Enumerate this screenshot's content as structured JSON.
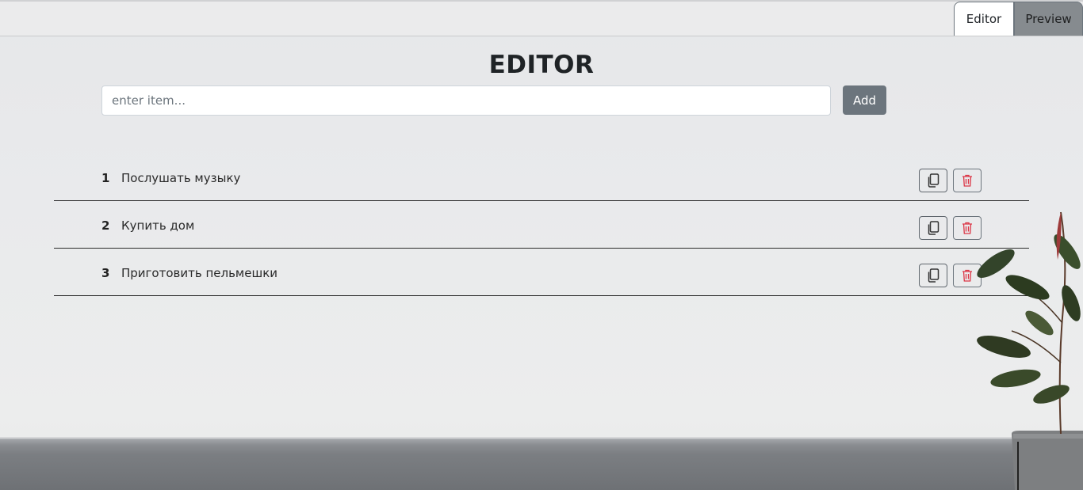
{
  "tabs": [
    {
      "label": "Editor",
      "active": true
    },
    {
      "label": "Preview",
      "active": false
    }
  ],
  "page_title": "EDITOR",
  "input": {
    "placeholder": "enter item...",
    "value": ""
  },
  "add_button_label": "Add",
  "items": [
    {
      "index": "1",
      "text": "Послушать музыку"
    },
    {
      "index": "2",
      "text": "Купить дом"
    },
    {
      "index": "3",
      "text": "Приготовить пельмешки"
    }
  ],
  "icons": {
    "copy": "copy-icon",
    "delete": "trash-icon"
  },
  "colors": {
    "secondary": "#6c757d",
    "danger": "#dc3545"
  }
}
